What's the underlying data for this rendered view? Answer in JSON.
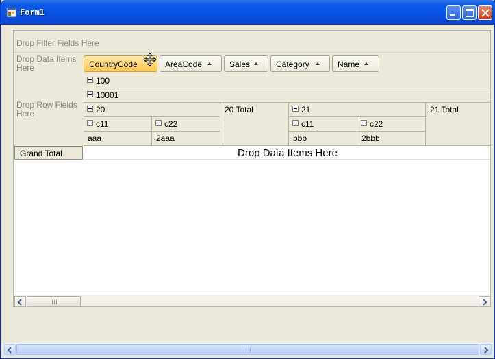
{
  "window": {
    "title": "Form1",
    "buttons": {
      "minimize": "minimize",
      "maximize": "maximize",
      "close": "close"
    }
  },
  "pivot": {
    "filter_area_text": "Drop Filter Fields Here",
    "data_items_area_text": "Drop Data Items Here",
    "row_fields_area_text": "Drop Row Fields Here",
    "field_buttons": [
      {
        "label": "CountryCode",
        "active": true
      },
      {
        "label": "AreaCode",
        "active": false
      },
      {
        "label": "Sales",
        "active": false
      },
      {
        "label": "Category",
        "active": false
      },
      {
        "label": "Name",
        "active": false
      }
    ],
    "columns": {
      "level1": "100",
      "level2": "10001",
      "groups": [
        {
          "label": "20",
          "total_label": "20 Total",
          "children": [
            {
              "label": "c11",
              "value": "aaa"
            },
            {
              "label": "c22",
              "value": "2aaa"
            }
          ]
        },
        {
          "label": "21",
          "total_label": "21 Total",
          "children": [
            {
              "label": "c11",
              "value": "bbb"
            },
            {
              "label": "c22",
              "value": "2bbb"
            }
          ]
        }
      ]
    },
    "grand_total_label": "Grand Total",
    "data_drop_text": "Drop Data Items Here",
    "scrollbar_grip": "III"
  },
  "colors": {
    "titlebar": "#0a5ae6",
    "active_field": "#ffc64d",
    "background": "#ece9d8"
  }
}
